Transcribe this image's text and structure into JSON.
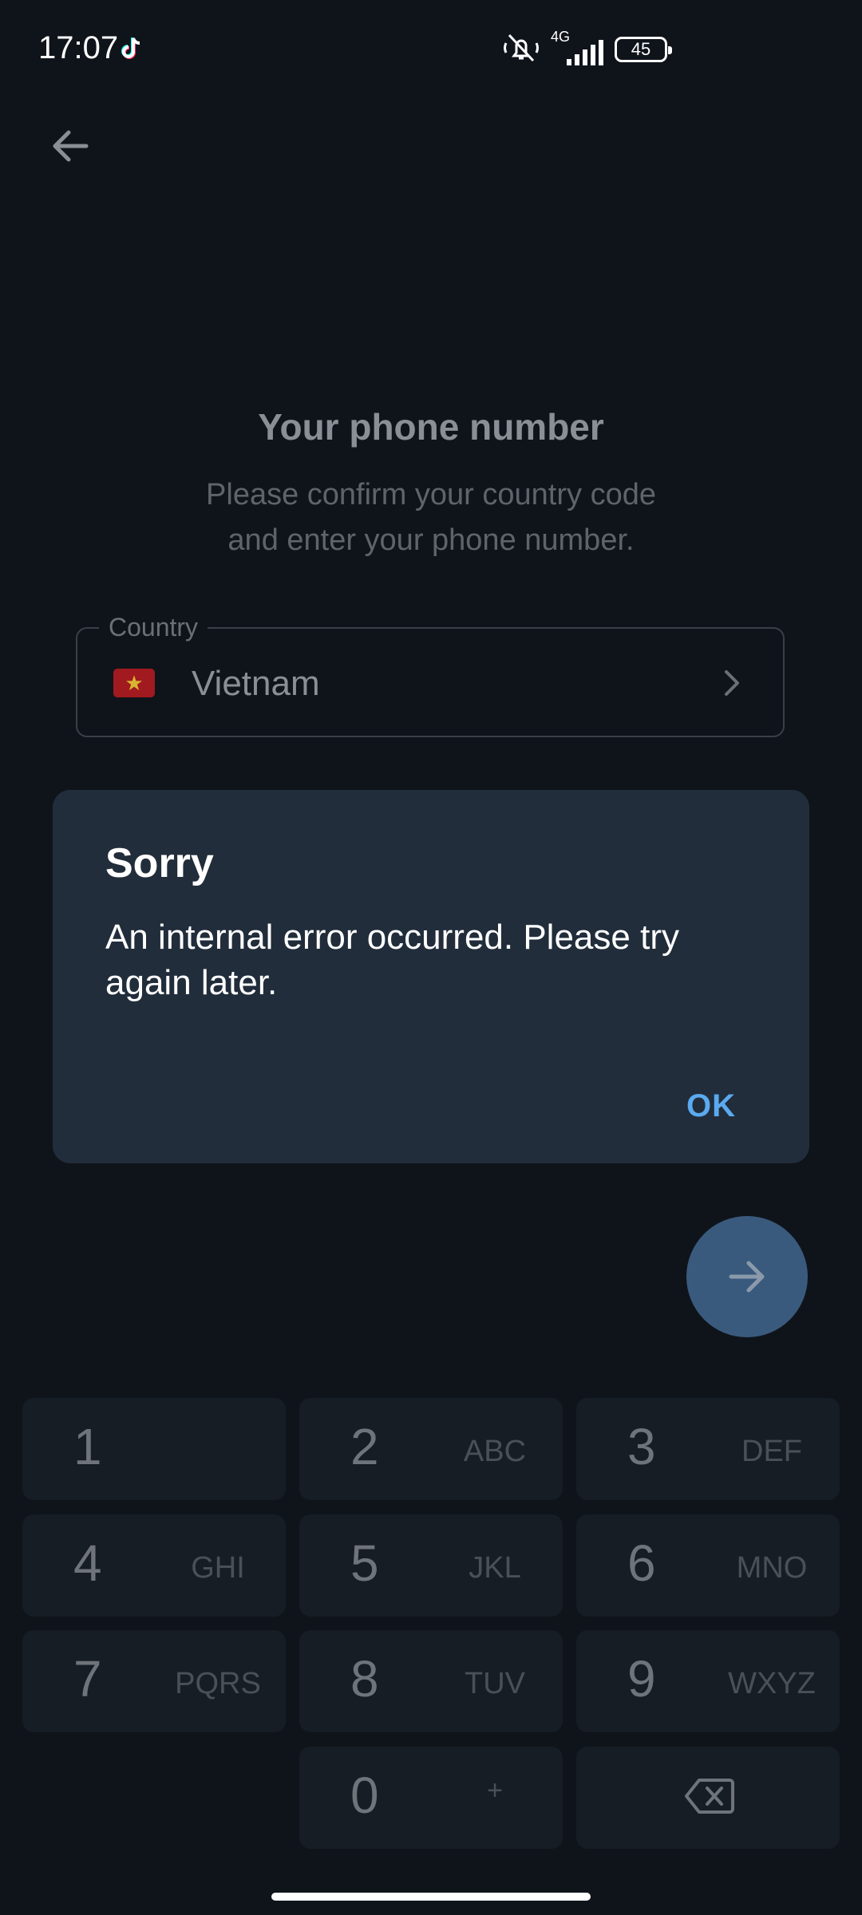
{
  "status_bar": {
    "time": "17:07",
    "network": "4G",
    "battery": "45",
    "icons": [
      "tiktok-icon",
      "mute-icon",
      "signal-icon",
      "battery-icon"
    ]
  },
  "header": {
    "back_icon": "arrow-left-icon"
  },
  "main": {
    "title": "Your phone number",
    "subtitle_line1": "Please confirm your country code",
    "subtitle_line2": "and enter your phone number.",
    "country_label": "Country",
    "country_name": "Vietnam",
    "country_flag": "vietnam-flag-icon"
  },
  "dialog": {
    "title": "Sorry",
    "message": "An internal error occurred. Please try again later.",
    "ok_label": "OK"
  },
  "fab": {
    "icon": "arrow-right-icon"
  },
  "keypad": {
    "keys": [
      {
        "num": "1",
        "letters": ""
      },
      {
        "num": "2",
        "letters": "ABC"
      },
      {
        "num": "3",
        "letters": "DEF"
      },
      {
        "num": "4",
        "letters": "GHI"
      },
      {
        "num": "5",
        "letters": "JKL"
      },
      {
        "num": "6",
        "letters": "MNO"
      },
      {
        "num": "7",
        "letters": "PQRS"
      },
      {
        "num": "8",
        "letters": "TUV"
      },
      {
        "num": "9",
        "letters": "WXYZ"
      },
      {
        "num": "0",
        "letters": "+"
      }
    ],
    "backspace_icon": "backspace-icon"
  },
  "colors": {
    "background": "#0f141b",
    "dialog": "#222d3b",
    "accent": "#5aaaf0",
    "fab": "#3a5a7d",
    "key": "#171d25"
  }
}
